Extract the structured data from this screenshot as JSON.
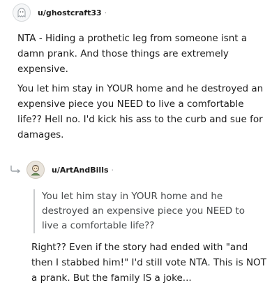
{
  "comments": [
    {
      "username": "u/ghostcraft33",
      "separator": "·",
      "avatar_icon": "ghost-avatar-icon",
      "paragraphs": [
        "NTA - Hiding a prothetic leg from someone isnt a damn prank. And those things are extremely expensive.",
        "You let him stay in YOUR home and he destroyed an expensive piece you NEED to live a comfortable life?? Hell no. I'd kick his ass to the curb and sue for damages."
      ]
    },
    {
      "username": "u/ArtAndBills",
      "separator": "·",
      "avatar_icon": "artist-avatar-icon",
      "reply_icon": "reply-arrow-icon",
      "quote": "You let him stay in YOUR home and he destroyed an expensive piece you NEED to live a comfortable life??",
      "text": "Right?? Even if the story had ended with \"and then I stabbed him!\" I'd still vote NTA. This is NOT a prank. But the family IS a joke..."
    }
  ],
  "colors": {
    "text": "#1c1c1c",
    "quote_text": "#4a4d4f",
    "quote_border": "#c9cbcd",
    "meta": "#878a8c"
  }
}
